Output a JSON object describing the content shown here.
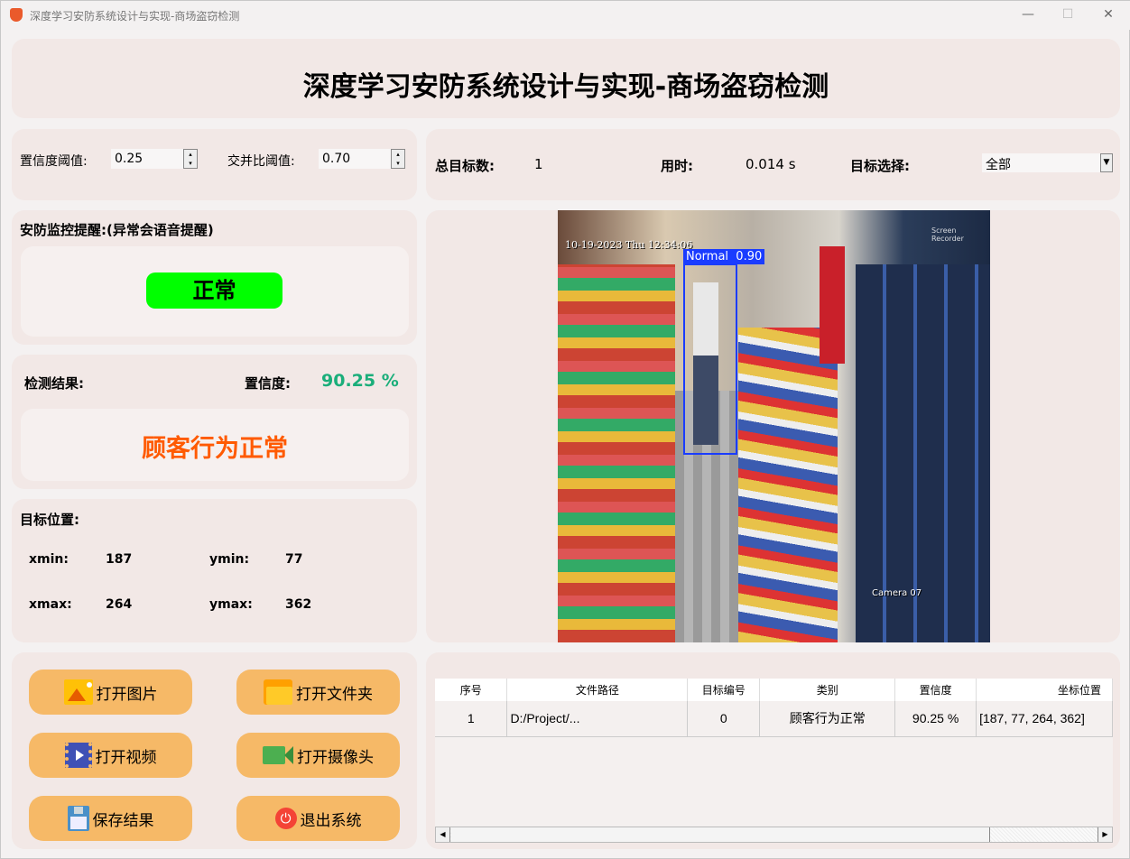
{
  "window": {
    "title": "深度学习安防系统设计与实现-商场盗窃检测",
    "minimize": "—",
    "maximize": "☐",
    "close": "✕"
  },
  "header": {
    "title": "深度学习安防系统设计与实现-商场盗窃检测"
  },
  "params": {
    "conf_label": "置信度阈值:",
    "conf_value": "0.25",
    "iou_label": "交并比阈值:",
    "iou_value": "0.70"
  },
  "stats": {
    "total_label": "总目标数:",
    "total_value": "1",
    "time_label": "用时:",
    "time_value": "0.014 s",
    "select_label": "目标选择:",
    "select_value": "全部"
  },
  "alert": {
    "title": "安防监控提醒:(异常会语音提醒)",
    "status": "正常",
    "status_color": "#00ff00"
  },
  "result": {
    "label": "检测结果:",
    "conf_label": "置信度:",
    "conf_value": "90.25 %",
    "text": "顾客行为正常",
    "text_color": "#ff5a00"
  },
  "position": {
    "title": "目标位置:",
    "xmin_label": "xmin:",
    "xmin": "187",
    "ymin_label": "ymin:",
    "ymin": "77",
    "xmax_label": "xmax:",
    "xmax": "264",
    "ymax_label": "ymax:",
    "ymax": "362"
  },
  "image": {
    "timestamp": "10-19-2023 Thu 12:34:06",
    "box_label": "Normal  0.90",
    "camera": "Camera 07",
    "watermark": "Screen Recorder"
  },
  "buttons": [
    {
      "label": "打开图片",
      "icon": "image-icon"
    },
    {
      "label": "打开文件夹",
      "icon": "folder-icon"
    },
    {
      "label": "打开视频",
      "icon": "video-icon"
    },
    {
      "label": "打开摄像头",
      "icon": "camera-icon"
    },
    {
      "label": "保存结果",
      "icon": "save-icon"
    },
    {
      "label": "退出系统",
      "icon": "power-icon"
    }
  ],
  "table": {
    "headers": [
      "序号",
      "文件路径",
      "目标编号",
      "类别",
      "置信度",
      "坐标位置"
    ],
    "rows": [
      [
        "1",
        "D:/Project/...",
        "0",
        "顾客行为正常",
        "90.25 %",
        "[187, 77, 264, 362]"
      ]
    ]
  }
}
